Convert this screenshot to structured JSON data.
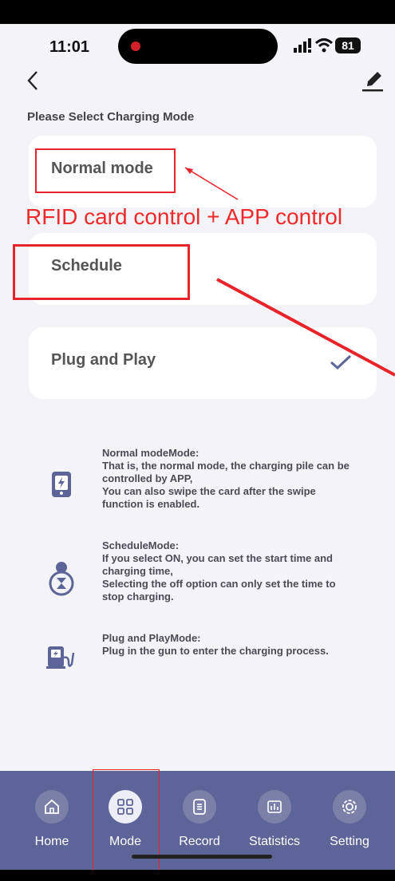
{
  "status_bar": {
    "time": "11:01",
    "battery": "81"
  },
  "page": {
    "title": "Please Select Charging Mode"
  },
  "modes": [
    {
      "label": "Normal mode",
      "selected": false
    },
    {
      "label": "Schedule",
      "selected": false
    },
    {
      "label": "Plug and Play",
      "selected": true
    }
  ],
  "annotation": {
    "text": "RFID card control + APP control"
  },
  "descriptions": [
    {
      "icon": "phone-charging-icon",
      "lines": [
        "Normal modeMode:",
        "That is, the normal mode, the charging pile can be",
        "controlled by APP,",
        "You can also swipe the card after the swipe",
        "function is enabled."
      ]
    },
    {
      "icon": "hourglass-icon",
      "lines": [
        "ScheduleMode:",
        "If you select ON, you can set the start time and",
        "charging time,",
        "Selecting the off option can only set the time to",
        "stop charging."
      ]
    },
    {
      "icon": "charger-plug-icon",
      "lines": [
        "Plug and PlayMode:",
        "Plug in the gun to enter the charging process."
      ]
    }
  ],
  "tabbar": [
    {
      "label": "Home",
      "icon": "home-icon",
      "active": false
    },
    {
      "label": "Mode",
      "icon": "grid-icon",
      "active": true
    },
    {
      "label": "Record",
      "icon": "list-icon",
      "active": false
    },
    {
      "label": "Statistics",
      "icon": "bar-chart-icon",
      "active": false
    },
    {
      "label": "Setting",
      "icon": "gear-icon",
      "active": false
    }
  ],
  "colors": {
    "tabbar": "#5d6498",
    "annotation": "#e8232a",
    "check": "#5d6498"
  }
}
